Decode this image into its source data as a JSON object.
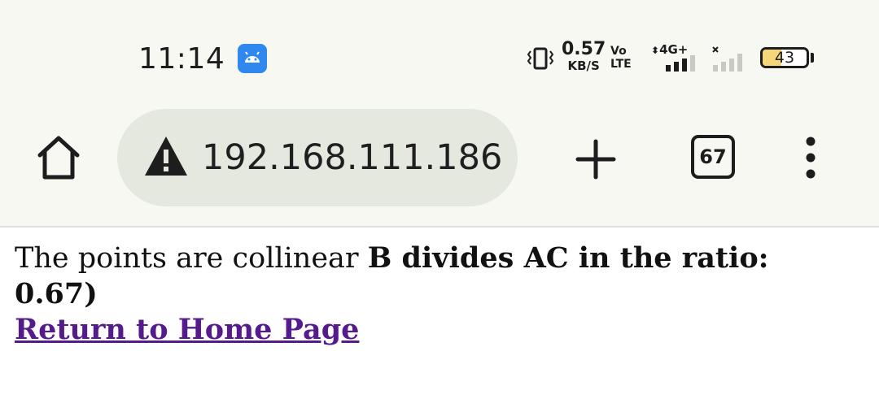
{
  "status_bar": {
    "time": "11:14",
    "notification_app_icon": "android-app-icon",
    "net_speed_value": "0.57",
    "net_speed_unit": "KB/S",
    "volte_top": "Vo",
    "volte_bottom": "LTE",
    "network_type": "4G+",
    "battery_level": "43",
    "battery_fraction": 0.43,
    "icons": [
      "vibrate-icon",
      "signal-strength-icon",
      "no-signal-icon",
      "battery-icon"
    ]
  },
  "browser": {
    "url": "192.168.111.186",
    "security_icon": "warning-triangle-icon",
    "tab_count": "67",
    "colors": {
      "toolbar_bg": "#f8f8f3",
      "urlbar_bg": "#e4e8de",
      "visited_link": "#551a8b"
    }
  },
  "page": {
    "message_plain": "The points are collinear ",
    "message_bold": "B divides AC in the ratio: 0.67)",
    "return_link": "Return to Home Page"
  }
}
